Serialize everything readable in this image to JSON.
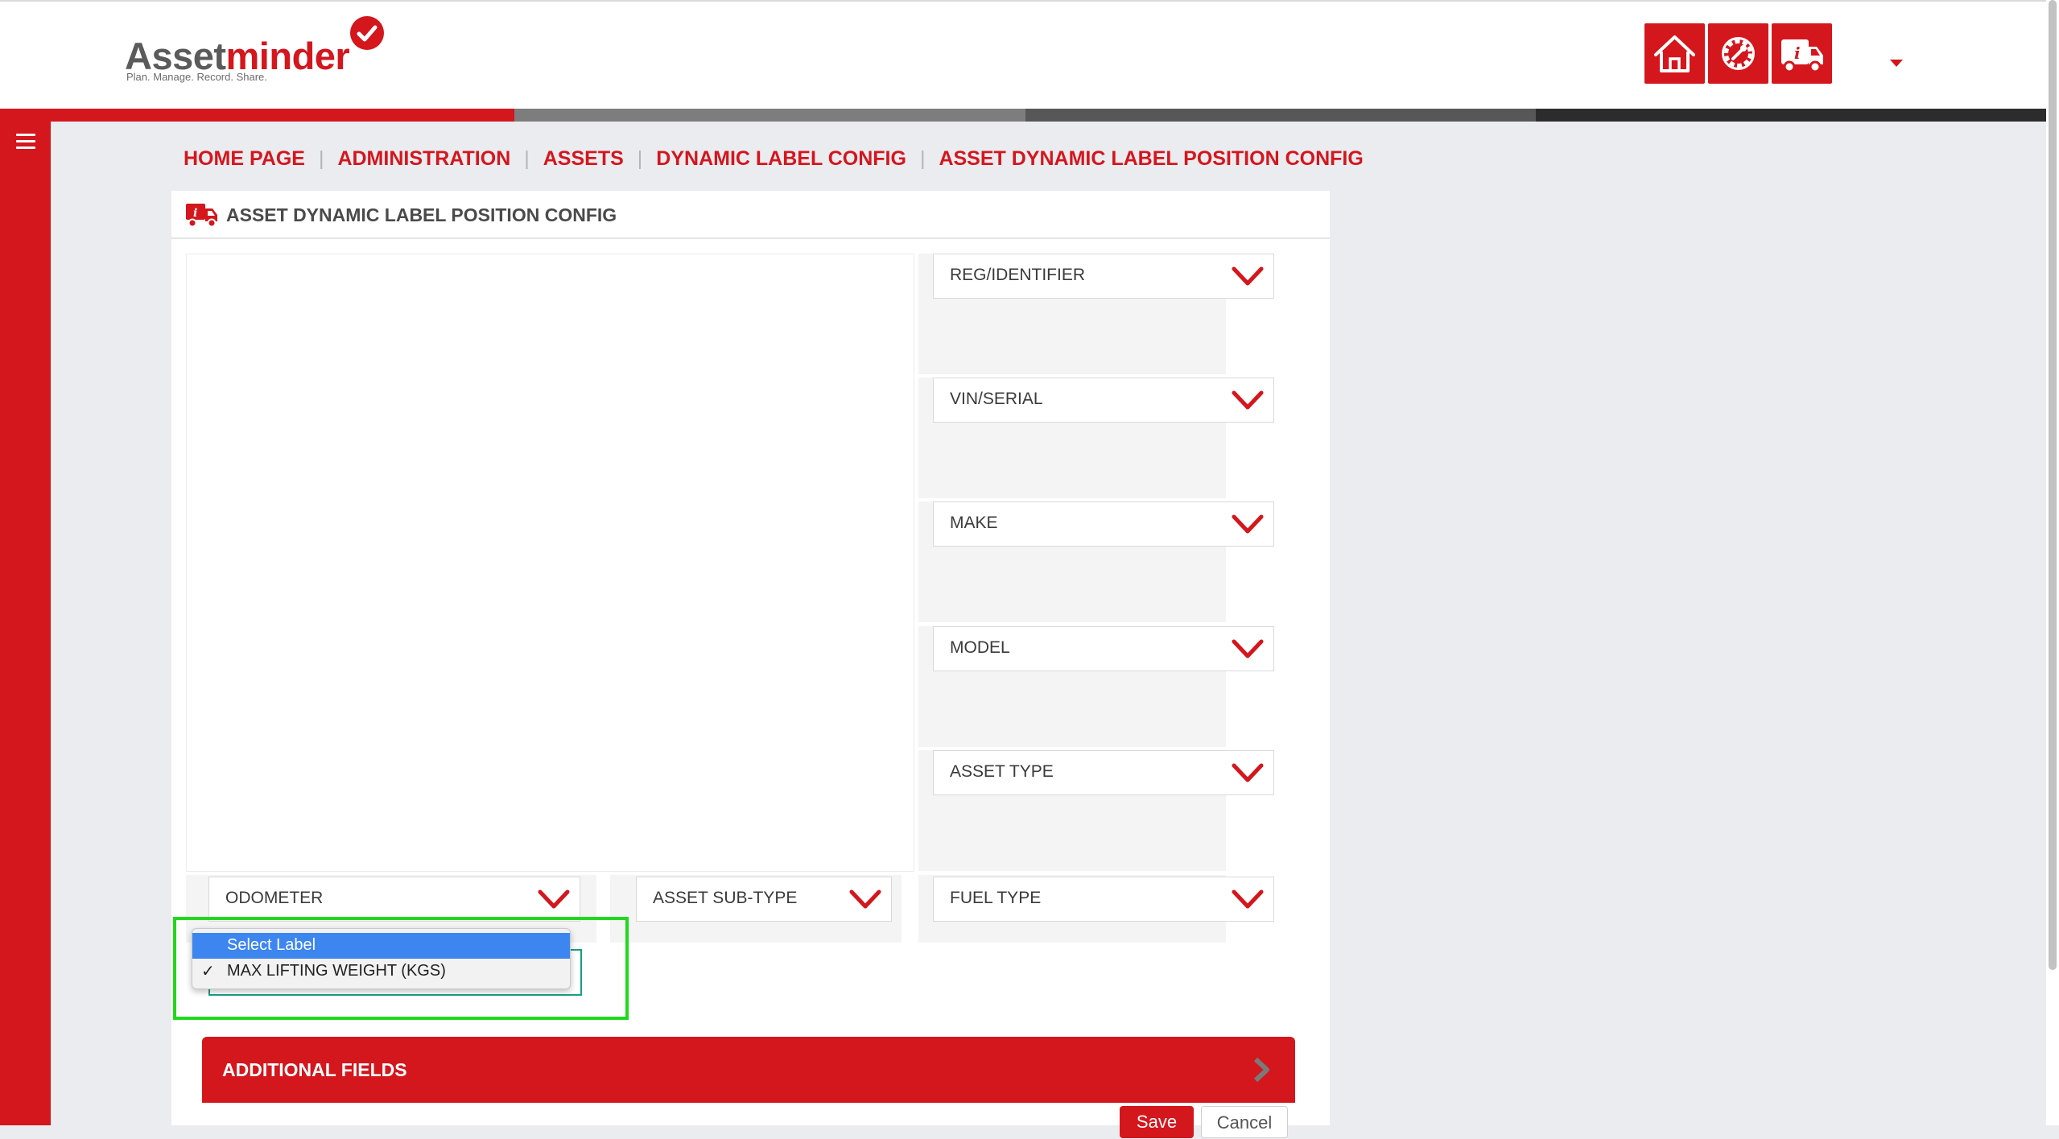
{
  "brand": {
    "name_part1": "Asset",
    "name_part2": "minder",
    "tagline": "Plan. Manage. Record. Share."
  },
  "header": {
    "buttons": [
      {
        "icon": "home-icon"
      },
      {
        "icon": "gear-wrench-icon"
      },
      {
        "icon": "info-truck-icon"
      }
    ],
    "user_menu_icon": "caret-down-icon"
  },
  "colors": {
    "brand_red": "#d4161d",
    "highlight_green": "#21d91c",
    "select_blue": "#3d86ef"
  },
  "breadcrumb": {
    "items": [
      {
        "label": "HOME PAGE"
      },
      {
        "label": "ADMINISTRATION"
      },
      {
        "label": "ASSETS"
      },
      {
        "label": "DYNAMIC LABEL CONFIG"
      },
      {
        "label": "ASSET DYNAMIC LABEL POSITION CONFIG"
      }
    ],
    "separator": "|"
  },
  "panel": {
    "title": "ASSET DYNAMIC LABEL POSITION CONFIG",
    "right_column": [
      {
        "label": "REG/IDENTIFIER"
      },
      {
        "label": "VIN/SERIAL"
      },
      {
        "label": "MAKE"
      },
      {
        "label": "MODEL"
      },
      {
        "label": "ASSET TYPE"
      }
    ],
    "bottom_row": [
      {
        "label": "ODOMETER"
      },
      {
        "label": "ASSET SUB-TYPE"
      },
      {
        "label": "FUEL TYPE"
      }
    ],
    "dropdown": {
      "options": [
        {
          "label": "Select Label",
          "highlighted": true
        },
        {
          "label": "MAX LIFTING WEIGHT (KGS)",
          "checked": true
        }
      ]
    },
    "additional_fields": "ADDITIONAL FIELDS",
    "save": "Save",
    "cancel": "Cancel"
  }
}
